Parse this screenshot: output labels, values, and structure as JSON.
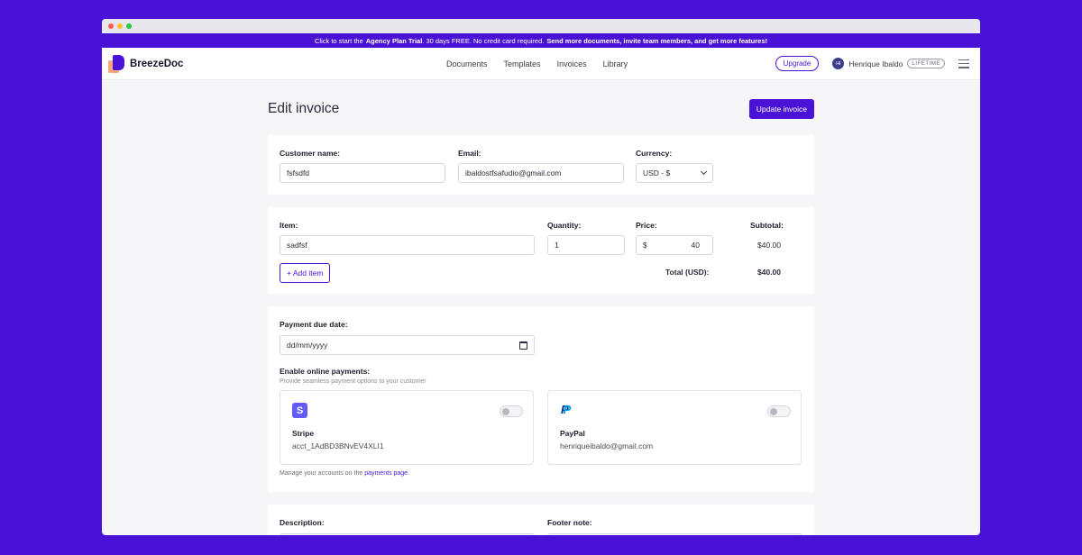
{
  "promo": {
    "prefix": "Click to start the",
    "plan": "Agency Plan Trial",
    "middle": ". 30 days FREE. No credit card required.",
    "cta": "Send more documents, invite team members, and get more features!"
  },
  "nav": {
    "brand": "BreezeDoc",
    "links": [
      "Documents",
      "Templates",
      "Invoices",
      "Library"
    ],
    "upgrade_label": "Upgrade",
    "user": {
      "initials": "HI",
      "name": "Henrique Ibaldo",
      "plan": "LIFETIME"
    }
  },
  "page": {
    "title": "Edit invoice",
    "update_label": "Update invoice"
  },
  "customer": {
    "name_label": "Customer name:",
    "name_value": "fsfsdfd",
    "email_label": "Email:",
    "email_value": "ibaldostfsafudio@gmail.com",
    "currency_label": "Currency:",
    "currency_value": "USD - $"
  },
  "items": {
    "headers": {
      "item": "Item:",
      "quantity": "Quantity:",
      "price": "Price:",
      "subtotal": "Subtotal:"
    },
    "rows": [
      {
        "name": "sadfsf",
        "quantity": "1",
        "currency_symbol": "$",
        "price": "40",
        "subtotal": "$40.00"
      }
    ],
    "add_label": "+ Add item",
    "total_label": "Total (USD):",
    "total_value": "$40.00"
  },
  "payment": {
    "due_label": "Payment due date:",
    "due_placeholder": "dd/mm/yyyy",
    "online_label": "Enable online payments:",
    "online_sub": "Provide seamless payment options to your customer",
    "stripe": {
      "name": "Stripe",
      "account": "acct_1AdBD3BNvEV4XLI1",
      "enabled": false
    },
    "paypal": {
      "name": "PayPal",
      "account": "henriqueibaldo@gmail.com",
      "enabled": false
    },
    "note_prefix": "Manage your accounts on the",
    "note_link": "payments page",
    "note_suffix": "."
  },
  "footer_fields": {
    "description_label": "Description:",
    "footer_label": "Footer note:"
  },
  "colors": {
    "brand": "#4a11d6",
    "background": "#f6f6f8",
    "stripe": "#635bff"
  }
}
